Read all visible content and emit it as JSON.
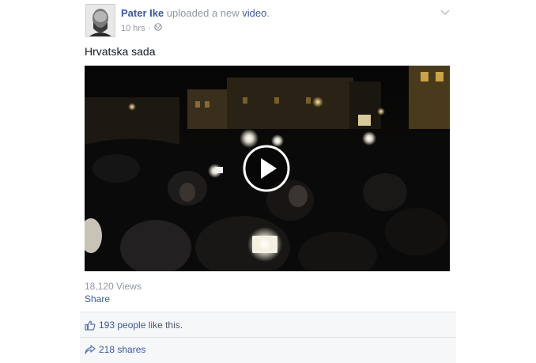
{
  "post": {
    "author": "Pater Ike",
    "action": "uploaded a new",
    "object_link": "video",
    "trailing": ".",
    "timestamp": "10 hrs",
    "separator": "·",
    "privacy_icon": "globe-icon",
    "text": "Hrvatska sada"
  },
  "video": {
    "play_icon": "play-icon",
    "views": "18,120 Views",
    "share_label": "Share"
  },
  "ufi": {
    "likes_count": "193 people",
    "likes_suffix": "like this.",
    "shares": "218 shares",
    "like_icon": "thumbs-up-icon",
    "share_icon": "share-arrow-icon"
  },
  "colors": {
    "link": "#3b5998",
    "muted": "#9197a3",
    "ufi_background": "#f6f7f9"
  }
}
